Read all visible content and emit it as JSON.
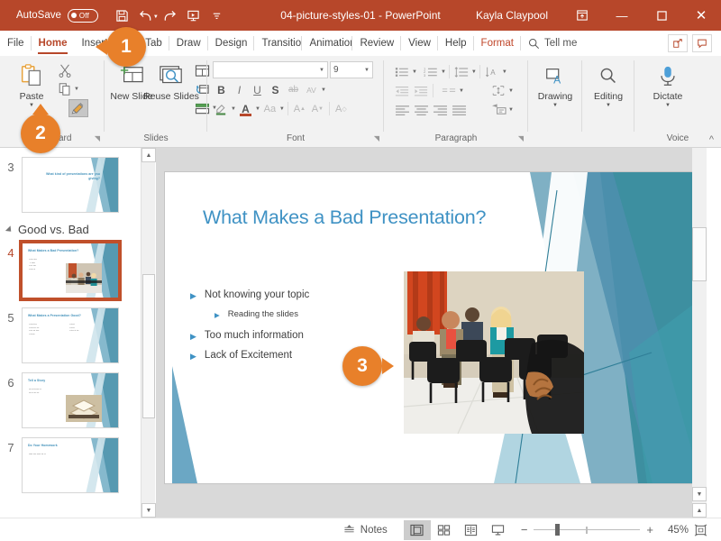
{
  "titlebar": {
    "autosave_label": "AutoSave",
    "autosave_state": "Off",
    "file_title": "04-picture-styles-01  -  PowerPoint",
    "user_name": "Kayla Claypool",
    "qat": [
      {
        "name": "save-icon",
        "label": "Save"
      },
      {
        "name": "undo-icon",
        "label": "Undo"
      },
      {
        "name": "redo-icon",
        "label": "Redo"
      },
      {
        "name": "start-slideshow-icon",
        "label": "Start From Beginning"
      },
      {
        "name": "customize-qat-icon",
        "label": "Customize Quick Access Toolbar"
      }
    ],
    "window_buttons": {
      "restore_up": "⇧",
      "minimize": "—",
      "maximize": "▢",
      "close": "✕"
    }
  },
  "tabs": [
    {
      "label": "File",
      "active": false
    },
    {
      "label": "Home",
      "active": true
    },
    {
      "label": "Insert",
      "active": false
    },
    {
      "label": "New Tab",
      "active": false
    },
    {
      "label": "Draw",
      "active": false
    },
    {
      "label": "Design",
      "active": false
    },
    {
      "label": "Transitions",
      "active": false
    },
    {
      "label": "Animations",
      "active": false
    },
    {
      "label": "Review",
      "active": false
    },
    {
      "label": "View",
      "active": false
    },
    {
      "label": "Help",
      "active": false
    },
    {
      "label": "Format",
      "active": false,
      "contextual": true
    }
  ],
  "tell_me": {
    "label": "Tell me",
    "icon": "search-icon"
  },
  "tabrow_right": [
    {
      "name": "share-button",
      "label": "Share"
    },
    {
      "name": "comments-button",
      "label": "Comments"
    }
  ],
  "ribbon": {
    "clipboard": {
      "group_label": "Clipboard",
      "paste_label": "Paste",
      "cut_label": "Cut",
      "copy_label": "Copy",
      "format_painter_label": "Format Painter",
      "format_painter_selected": true,
      "dialog_launcher": "⌐"
    },
    "slides": {
      "group_label": "Slides",
      "new_slide_label": "New Slide",
      "reuse_slides_label": "Reuse Slides",
      "layout_label": "Layout",
      "reset_label": "Reset",
      "section_label": "Section"
    },
    "font": {
      "group_label": "Font",
      "font_name_value": "",
      "font_size_value": "9",
      "bold": "B",
      "italic": "I",
      "underline": "U",
      "shadow": "S",
      "strikethrough": "ab",
      "char_spacing": "AV",
      "text_highlight": "A",
      "font_color": "A",
      "change_case": "Aa",
      "increase_size": "A",
      "decrease_size": "A",
      "clear_formatting": "A"
    },
    "paragraph": {
      "group_label": "Paragraph",
      "bullets": "Bullets",
      "numbering": "Numbering",
      "line_spacing": "Line Spacing",
      "text_direction": "Text Direction",
      "decrease_indent": "Decrease Indent",
      "increase_indent": "Increase Indent",
      "align_text": "Align Text",
      "columns": "Columns",
      "align_left": "Align Left",
      "align_center": "Center",
      "align_right": "Align Right",
      "justify": "Justify",
      "convert_smartart": "Convert to SmartArt"
    },
    "drawing": {
      "group_label": "",
      "label": "Drawing"
    },
    "editing": {
      "group_label": "",
      "label": "Editing"
    },
    "voice": {
      "group_label": "Voice",
      "label": "Dictate"
    },
    "collapse_ribbon": "^"
  },
  "thumbnails": {
    "section_label": "Good vs. Bad",
    "slides": [
      {
        "number": "3",
        "title": "What kind of presentations are you giving?",
        "selected": false
      },
      {
        "number": "4",
        "title": "What Makes a Bad Presentation?",
        "selected": true
      },
      {
        "number": "5",
        "title": "What Makes a Presentation Good?",
        "selected": false
      },
      {
        "number": "6",
        "title": "Tell a Story",
        "selected": false
      },
      {
        "number": "7",
        "title": "Do Your Homework",
        "selected": false
      }
    ]
  },
  "slide": {
    "title": "What Makes a Bad Presentation?",
    "bullets": [
      {
        "text": "Not knowing your topic",
        "level": 1
      },
      {
        "text": "Reading the slides",
        "level": 2
      },
      {
        "text": "Too much information",
        "level": 1
      },
      {
        "text": "Lack of Excitement",
        "level": 1
      }
    ],
    "image_alt": "Bored audience sleeping in a conference room"
  },
  "status": {
    "notes_label": "Notes",
    "views": [
      {
        "name": "normal-view",
        "label": "Normal",
        "active": true
      },
      {
        "name": "slide-sorter-view",
        "label": "Slide Sorter",
        "active": false
      },
      {
        "name": "reading-view",
        "label": "Reading View",
        "active": false
      },
      {
        "name": "slideshow-view",
        "label": "Slide Show",
        "active": false
      }
    ],
    "zoom_out": "−",
    "zoom_in": "+",
    "zoom_percent": "45%",
    "fit_label": "Fit slide to current window"
  },
  "callouts": [
    {
      "number": "1",
      "target": "insert-tab"
    },
    {
      "number": "2",
      "target": "format-painter-button"
    },
    {
      "number": "3",
      "target": "slide-picture"
    }
  ],
  "colors": {
    "titlebar": "#b7472a",
    "accent_red": "#b7472a",
    "badge_orange": "#e8802a",
    "slide_title_blue": "#3f92c4",
    "ribbon_bg": "#f2f2f2"
  }
}
